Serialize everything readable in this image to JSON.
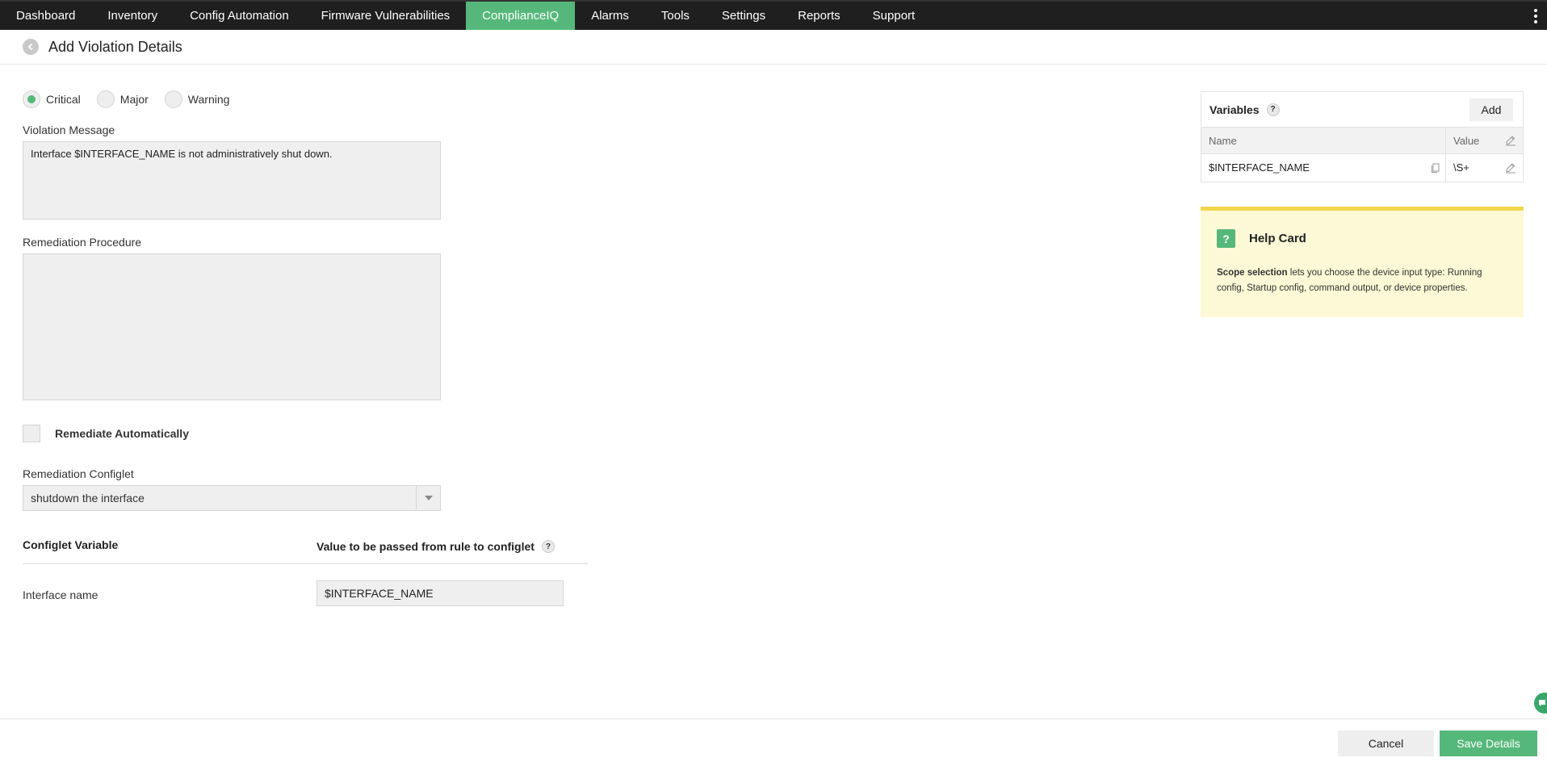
{
  "nav": {
    "items": [
      {
        "label": "Dashboard"
      },
      {
        "label": "Inventory"
      },
      {
        "label": "Config Automation"
      },
      {
        "label": "Firmware Vulnerabilities"
      },
      {
        "label": "ComplianceIQ"
      },
      {
        "label": "Alarms"
      },
      {
        "label": "Tools"
      },
      {
        "label": "Settings"
      },
      {
        "label": "Reports"
      },
      {
        "label": "Support"
      }
    ],
    "active": "ComplianceIQ"
  },
  "header": {
    "title": "Add Violation Details"
  },
  "severity": {
    "options": [
      {
        "label": "Critical",
        "checked": true
      },
      {
        "label": "Major",
        "checked": false
      },
      {
        "label": "Warning",
        "checked": false
      }
    ]
  },
  "violation_message": {
    "label": "Violation Message",
    "value": "Interface $INTERFACE_NAME is not administratively shut down."
  },
  "remediation_procedure": {
    "label": "Remediation Procedure",
    "value": ""
  },
  "remediate_auto": {
    "label": "Remediate Automatically",
    "checked": false
  },
  "remediation_configlet": {
    "label": "Remediation Configlet",
    "selected": "shutdown the interface"
  },
  "configlet_vars": {
    "col_variable": "Configlet Variable",
    "col_value": "Value to be passed from rule to configlet",
    "rows": [
      {
        "name": "Interface name",
        "value": "$INTERFACE_NAME"
      }
    ]
  },
  "variables": {
    "title": "Variables",
    "add_label": "Add",
    "col_name": "Name",
    "col_value": "Value",
    "rows": [
      {
        "name": "$INTERFACE_NAME",
        "value": "\\S+"
      }
    ]
  },
  "help_card": {
    "title": "Help Card",
    "bold": "Scope selection",
    "body": " lets you choose the device input type: Running config, Startup config, command output, or device properties."
  },
  "footer": {
    "cancel_label": "Cancel",
    "save_label": "Save Details"
  },
  "colors": {
    "accent": "#55b87a",
    "nav_bg": "#1f1f1f",
    "help_bg": "#fdf8d6",
    "help_border": "#f2d64b"
  }
}
